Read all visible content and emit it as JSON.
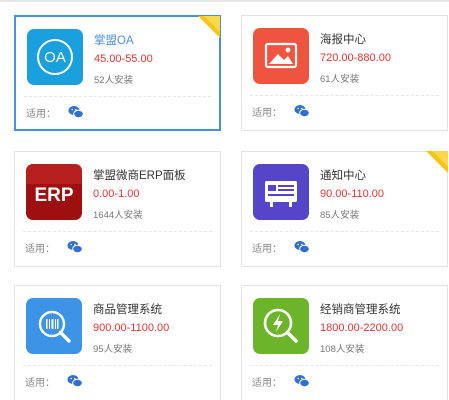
{
  "apps": [
    {
      "name": "掌盟OA",
      "price": "45.00-55.00",
      "installs": "52人安装",
      "footer_label": "适用：",
      "icon": "oa-icon",
      "icon_text": "OA",
      "hot": true,
      "selected": true,
      "color": "#1aa0dc"
    },
    {
      "name": "海报中心",
      "price": "720.00-880.00",
      "installs": "61人安装",
      "footer_label": "适用：",
      "icon": "poster-icon",
      "hot": false,
      "selected": false,
      "color": "#ef5440"
    },
    {
      "name": "掌盟微商ERP面板",
      "price": "0.00-1.00",
      "installs": "1644人安装",
      "footer_label": "适用：",
      "icon": "erp-icon",
      "icon_text": "ERP",
      "hot": false,
      "selected": false,
      "color": "#9e1010"
    },
    {
      "name": "通知中心",
      "price": "90.00-110.00",
      "installs": "85人安装",
      "footer_label": "适用：",
      "icon": "notice-icon",
      "hot": true,
      "selected": false,
      "color": "#5545c8"
    },
    {
      "name": "商品管理系统",
      "price": "900.00-1100.00",
      "installs": "95人安装",
      "footer_label": "适用：",
      "icon": "product-icon",
      "hot": false,
      "selected": false,
      "color": "#3d93e6"
    },
    {
      "name": "经销商管理系统",
      "price": "1800.00-2200.00",
      "installs": "108人安装",
      "footer_label": "适用：",
      "icon": "dealer-icon",
      "hot": false,
      "selected": false,
      "color": "#6cb52b"
    }
  ],
  "colors": {
    "price": "#e23434",
    "selected_border": "#4a90d9",
    "wechat": "#2f6fd1",
    "hot_badge": "#f5c518"
  }
}
